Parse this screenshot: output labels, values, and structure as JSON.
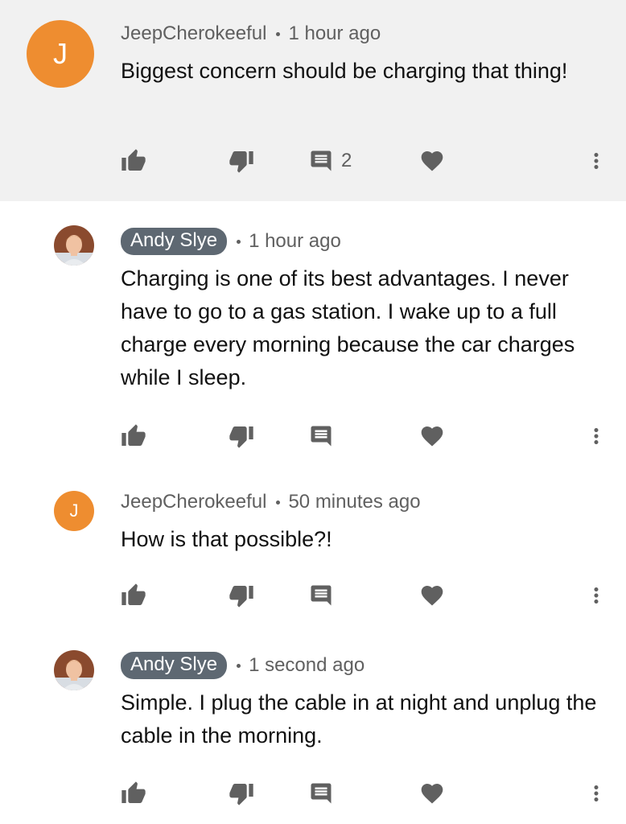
{
  "comments": [
    {
      "author": "JeepCherokeeful",
      "time": "1 hour ago",
      "text": "Biggest concern should be charging that thing!",
      "avatar_letter": "J",
      "avatar_color": "#ee8d30",
      "reply_count": "2",
      "highlighted": true
    },
    {
      "author": "Andy Slye",
      "time": "1 hour ago",
      "text": "Charging is one of its best advantages. I never have to go to a gas station. I wake up to a full charge every morning because the car charges while I sleep.",
      "is_creator": true
    },
    {
      "author": "JeepCherokeeful",
      "time": "50 minutes ago",
      "text": "How is that possible?!",
      "avatar_letter": "J",
      "avatar_color": "#ee8d30"
    },
    {
      "author": "Andy Slye",
      "time": "1 second ago",
      "text": "Simple. I plug the cable in at night and unplug the cable in the morning.",
      "is_creator": true
    }
  ],
  "icons": {
    "like": "thumbs-up-icon",
    "dislike": "thumbs-down-icon",
    "reply": "comment-icon",
    "heart": "heart-icon",
    "more": "more-vertical-icon"
  },
  "colors": {
    "icon_gray": "#606060",
    "creator_badge": "#5e6872",
    "highlight_bg": "#f1f1f1",
    "letter_avatar": "#ee8d30"
  }
}
